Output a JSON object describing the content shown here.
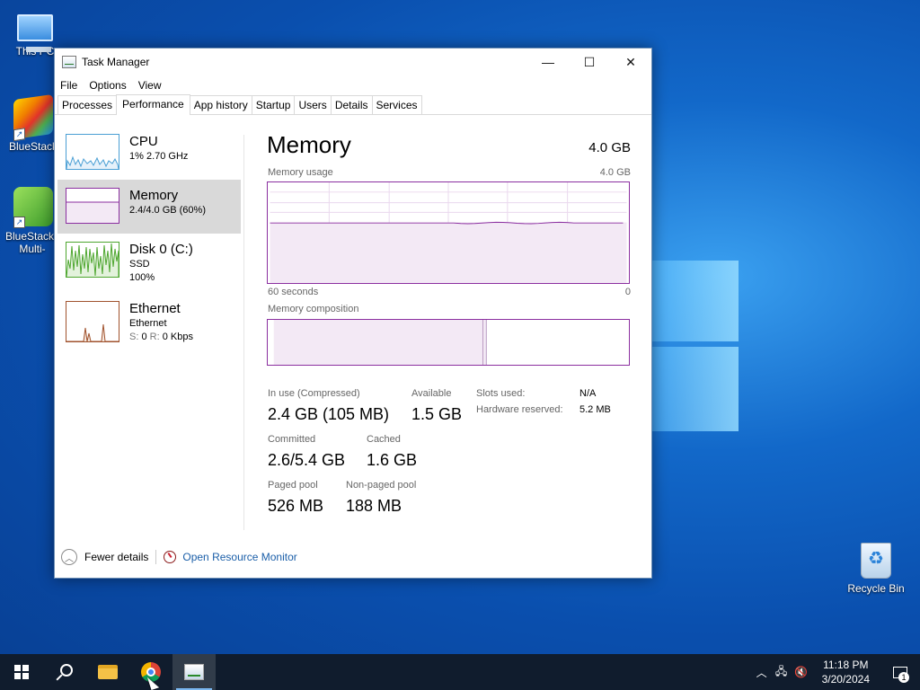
{
  "desktop": {
    "icons": [
      {
        "label": "This PC",
        "icon": "computer-icon"
      },
      {
        "label": "BlueStacks",
        "icon": "bluestacks-icon"
      },
      {
        "label": "BlueStacks Multi-Instance",
        "icon": "bluestacks-multi-icon"
      },
      {
        "label": "Recycle Bin",
        "icon": "recycle-bin-icon"
      }
    ]
  },
  "window": {
    "title": "Task Manager",
    "controls": {
      "minimize": "—",
      "maximize": "☐",
      "close": "✕"
    },
    "menu": [
      "File",
      "Options",
      "View"
    ],
    "tabs": [
      "Processes",
      "Performance",
      "App history",
      "Startup",
      "Users",
      "Details",
      "Services"
    ],
    "active_tab": "Performance"
  },
  "sidebar": {
    "items": [
      {
        "name": "CPU",
        "line1": "1%  2.70 GHz",
        "line2": "",
        "color": "#4a9fd4"
      },
      {
        "name": "Memory",
        "line1": "2.4/4.0 GB (60%)",
        "line2": "",
        "color": "#8b2fa0"
      },
      {
        "name": "Disk 0 (C:)",
        "line1": "SSD",
        "line2": "100%",
        "color": "#4da62e"
      },
      {
        "name": "Ethernet",
        "line1": "Ethernet",
        "line2_label": "S:",
        "line2_s": " 0 ",
        "line2_r_label": "R:",
        "line2_r": " 0 Kbps",
        "color": "#a0522d"
      }
    ],
    "active": "Memory"
  },
  "memory": {
    "title": "Memory",
    "total": "4.0 GB",
    "usage_label": "Memory usage",
    "usage_max": "4.0 GB",
    "time_left": "60 seconds",
    "time_right": "0",
    "usage_fraction": 0.6,
    "composition_label": "Memory composition",
    "composition_in_use_fraction": 0.6,
    "stats": {
      "in_use_label": "In use (Compressed)",
      "in_use_value": "2.4 GB (105 MB)",
      "available_label": "Available",
      "available_value": "1.5 GB",
      "committed_label": "Committed",
      "committed_value": "2.6/5.4 GB",
      "cached_label": "Cached",
      "cached_value": "1.6 GB",
      "paged_label": "Paged pool",
      "paged_value": "526 MB",
      "nonpaged_label": "Non-paged pool",
      "nonpaged_value": "188 MB",
      "slots_label": "Slots used:",
      "slots_value": "N/A",
      "hw_reserved_label": "Hardware reserved:",
      "hw_reserved_value": "5.2 MB"
    }
  },
  "footer": {
    "fewer_details": "Fewer details",
    "open_resource_monitor": "Open Resource Monitor"
  },
  "taskbar": {
    "apps": [
      "start",
      "search",
      "file-explorer",
      "chrome",
      "task-manager"
    ],
    "time": "11:18 PM",
    "date": "3/20/2024",
    "notification_count": "1"
  }
}
